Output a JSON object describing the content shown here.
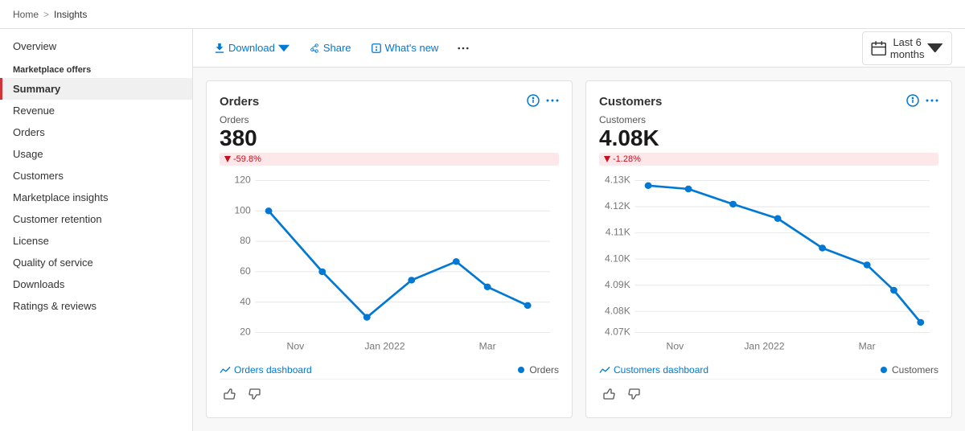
{
  "breadcrumb": {
    "home": "Home",
    "separator": ">",
    "current": "Insights"
  },
  "sidebar": {
    "overview": "Overview",
    "section_label": "Marketplace offers",
    "items": [
      {
        "id": "summary",
        "label": "Summary",
        "active": true
      },
      {
        "id": "revenue",
        "label": "Revenue",
        "active": false
      },
      {
        "id": "orders",
        "label": "Orders",
        "active": false
      },
      {
        "id": "usage",
        "label": "Usage",
        "active": false
      },
      {
        "id": "customers",
        "label": "Customers",
        "active": false
      },
      {
        "id": "marketplace-insights",
        "label": "Marketplace insights",
        "active": false
      },
      {
        "id": "customer-retention",
        "label": "Customer retention",
        "active": false
      },
      {
        "id": "license",
        "label": "License",
        "active": false
      },
      {
        "id": "quality-of-service",
        "label": "Quality of service",
        "active": false
      },
      {
        "id": "downloads",
        "label": "Downloads",
        "active": false
      },
      {
        "id": "ratings-reviews",
        "label": "Ratings & reviews",
        "active": false
      }
    ]
  },
  "toolbar": {
    "download": "Download",
    "share": "Share",
    "whats_new": "What's new",
    "period": "Last 6 months"
  },
  "cards": [
    {
      "id": "orders",
      "title": "Orders",
      "metric_label": "Orders",
      "metric_value": "380",
      "badge": "-59.8%",
      "chart": {
        "x_labels": [
          "Nov",
          "Jan 2022",
          "Mar"
        ],
        "y_labels": [
          "120",
          "100",
          "80",
          "60",
          "40",
          "20"
        ],
        "points": [
          {
            "x": 0.04,
            "y": 0.17
          },
          {
            "x": 0.22,
            "y": 0.52
          },
          {
            "x": 0.35,
            "y": 0.83
          },
          {
            "x": 0.5,
            "y": 0.55
          },
          {
            "x": 0.65,
            "y": 0.4
          },
          {
            "x": 0.8,
            "y": 0.6
          },
          {
            "x": 0.95,
            "y": 0.75
          }
        ]
      },
      "legend_label": "Orders",
      "dashboard_link": "Orders dashboard"
    },
    {
      "id": "customers",
      "title": "Customers",
      "metric_label": "Customers",
      "metric_value": "4.08K",
      "badge": "-1.28%",
      "chart": {
        "x_labels": [
          "Nov",
          "Jan 2022",
          "Mar"
        ],
        "y_labels": [
          "4.13K",
          "4.12K",
          "4.11K",
          "4.10K",
          "4.09K",
          "4.08K",
          "4.07K"
        ],
        "points": [
          {
            "x": 0.04,
            "y": 0.08
          },
          {
            "x": 0.2,
            "y": 0.1
          },
          {
            "x": 0.35,
            "y": 0.22
          },
          {
            "x": 0.5,
            "y": 0.3
          },
          {
            "x": 0.65,
            "y": 0.52
          },
          {
            "x": 0.8,
            "y": 0.65
          },
          {
            "x": 0.88,
            "y": 0.75
          },
          {
            "x": 0.97,
            "y": 0.9
          }
        ]
      },
      "legend_label": "Customers",
      "dashboard_link": "Customers dashboard"
    }
  ]
}
